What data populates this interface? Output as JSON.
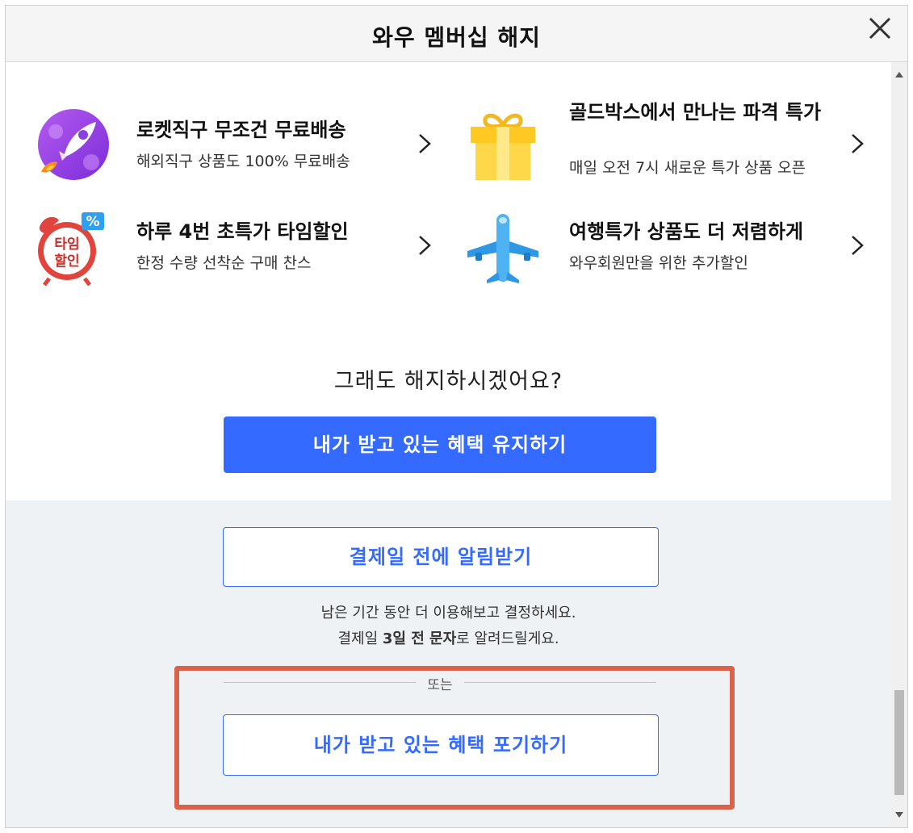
{
  "dialog": {
    "title": "와우 멤버십 해지"
  },
  "cut_off_text": "· · · · · · ·",
  "benefits": [
    {
      "title": "로켓직구 무조건 무료배송",
      "desc": "해외직구 상품도 100% 무료배송",
      "icon": "rocket-icon"
    },
    {
      "title": "골드박스에서 만나는 파격 특가",
      "desc": "매일 오전 7시 새로운 특가 상품 오픈",
      "icon": "gift-box-icon"
    },
    {
      "title": "하루 4번 초특가 타임할인",
      "desc": "한정 수량 선착순 구매 찬스",
      "icon": "alarm-clock-icon",
      "badge_text": "타임\n할인",
      "badge_symbol": "%"
    },
    {
      "title": "여행특가 상품도 더 저렴하게",
      "desc": "와우회원만을 위한 추가할인",
      "icon": "airplane-icon"
    }
  ],
  "question": "그래도 해지하시겠어요?",
  "buttons": {
    "keep": "내가 받고 있는 혜택 유지하기",
    "notify": "결제일 전에 알림받기",
    "give_up": "내가 받고 있는 혜택 포기하기"
  },
  "notice": {
    "line1": "남은 기간 동안 더 이용해보고 결정하세요.",
    "line2_prefix": "결제일 ",
    "line2_bold1": "3일 전 문자",
    "line2_suffix": "로 알려드릴게요."
  },
  "divider_text": "또는",
  "colors": {
    "primary": "#346aff",
    "highlight_outline": "#d9624a",
    "gray_background": "#eef2f5"
  }
}
